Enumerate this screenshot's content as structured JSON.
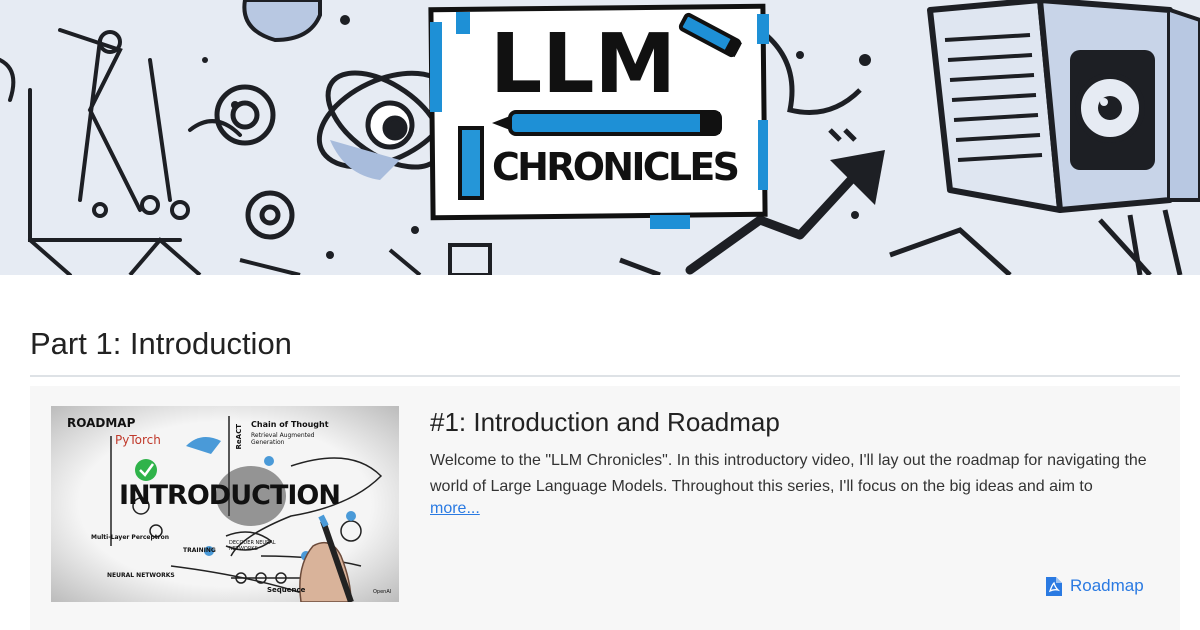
{
  "banner": {
    "logo_line1": "LLM",
    "logo_line2": "CHRONICLES"
  },
  "section": {
    "title": "Part 1: Introduction"
  },
  "episode": {
    "title": "#1: Introduction and Roadmap",
    "description": "Welcome to the \"LLM Chronicles\". In this introductory video, I'll lay out the roadmap for navigating the world of Large Language Models. Throughout this series, I'll focus on the big ideas and aim to",
    "more_label": "more...",
    "resource_label": "Roadmap",
    "resource_icon": "file-pdf-icon",
    "thumbnail": {
      "roadmap": "ROADMAP",
      "pytorch": "PyTorch",
      "intro": "INTRODUCTION",
      "chain": "Chain of Thought",
      "retrieval": "Retrieval Augmented Generation",
      "react": "ReACT",
      "mlp": "Multi-Layer Perceptron",
      "training": "TRAINING",
      "neural": "NEURAL NETWORKS",
      "decoder": "DECODER NEURAL NETWORKS",
      "sequence": "Sequence",
      "openai": "OpenAI"
    }
  },
  "colors": {
    "accent_blue": "#1e90d6",
    "link": "#2a7ae2"
  }
}
